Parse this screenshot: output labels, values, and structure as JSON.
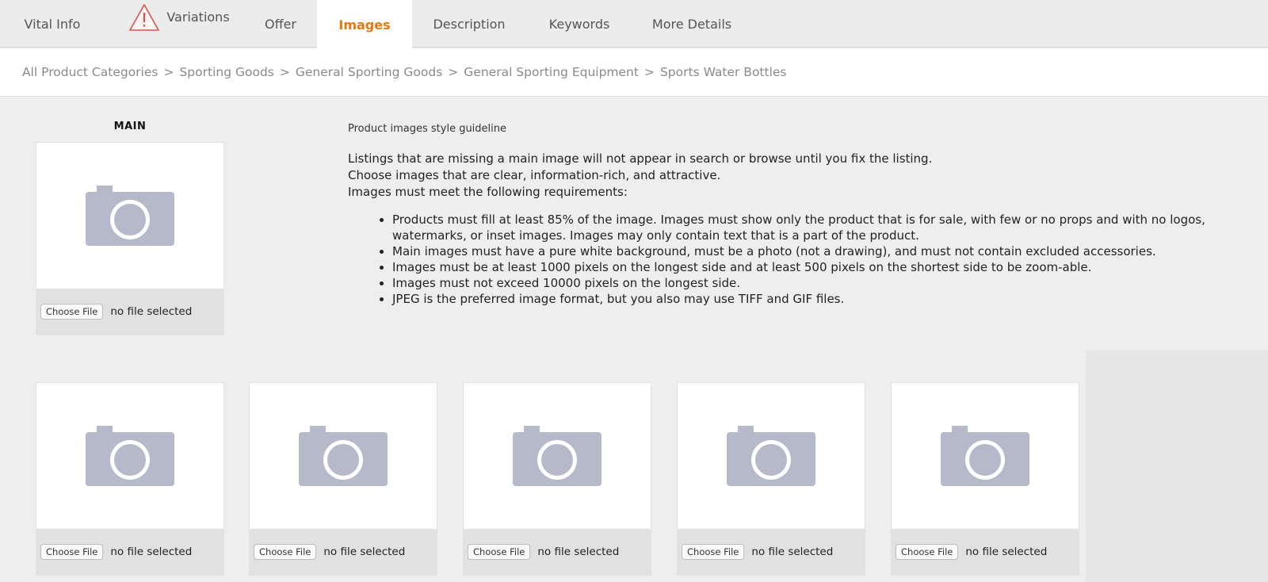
{
  "tabs": [
    {
      "label": "Vital Info"
    },
    {
      "label": "Variations",
      "warning": true
    },
    {
      "label": "Offer"
    },
    {
      "label": "Images",
      "active": true
    },
    {
      "label": "Description"
    },
    {
      "label": "Keywords"
    },
    {
      "label": "More Details"
    }
  ],
  "breadcrumb": [
    "All Product Categories",
    "Sporting Goods",
    "General Sporting Goods",
    "General Sporting Equipment",
    "Sports Water Bottles"
  ],
  "breadcrumb_separator": ">",
  "main_label": "MAIN",
  "file": {
    "button_label": "Choose File",
    "status": "no file selected"
  },
  "guideline": {
    "title": "Product images style guideline",
    "intro": [
      "Listings that are missing a main image will not appear in search or browse until you fix the listing.",
      "Choose images that are clear, information-rich, and attractive.",
      "Images must meet the following requirements:"
    ],
    "requirements": [
      "Products must fill at least 85% of the image. Images must show only the product that is for sale, with few or no props and with no logos, watermarks, or inset images. Images may only contain text that is a part of the product.",
      "Main images must have a pure white background, must be a photo (not a drawing), and must not contain excluded accessories.",
      "Images must be at least 1000 pixels on the longest side and at least 500 pixels on the shortest side to be zoom-able.",
      "Images must not exceed 10000 pixels on the longest side.",
      "JPEG is the preferred image format, but you also may use TIFF and GIF files."
    ]
  },
  "colors": {
    "active_tab": "#e47911",
    "placeholder": "#b5b9c9",
    "warning": "#d9534f"
  },
  "icons": {
    "warning": "warning-triangle-icon",
    "placeholder": "camera-icon"
  }
}
